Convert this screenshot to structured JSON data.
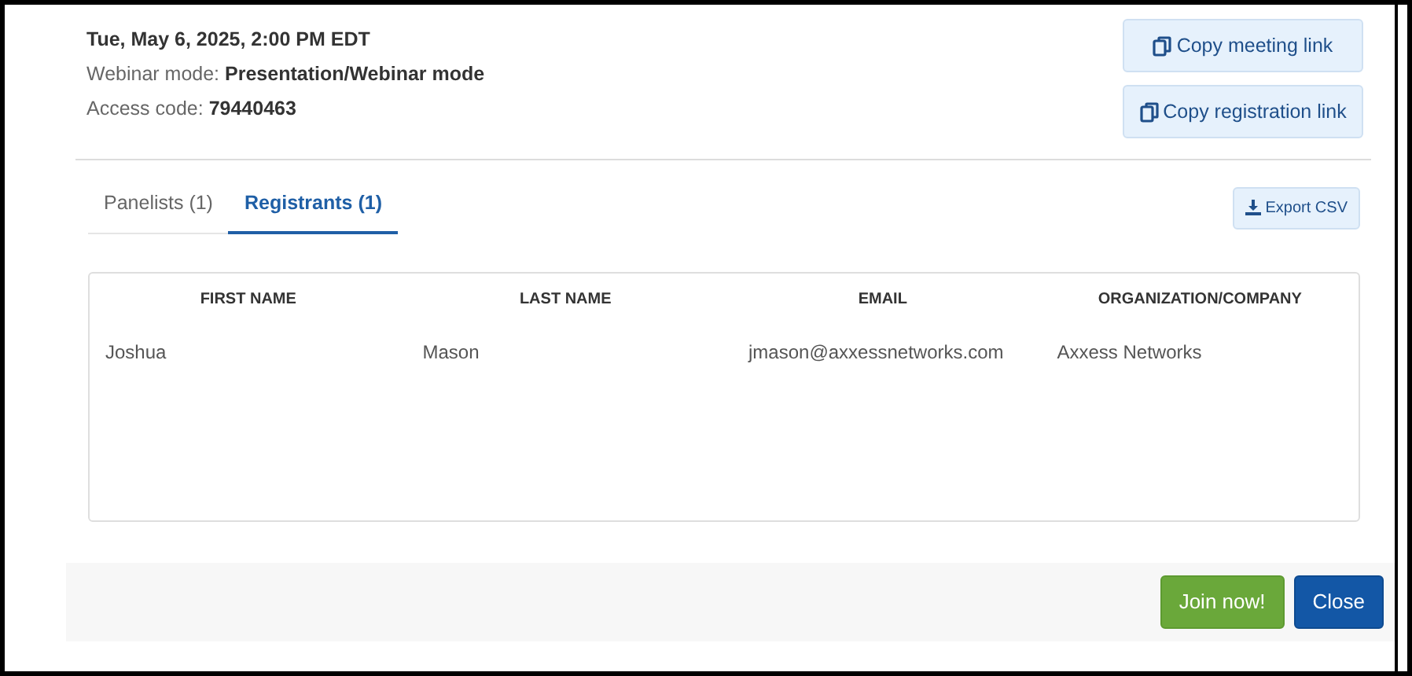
{
  "meeting": {
    "datetime": "Tue, May 6, 2025, 2:00 PM EDT",
    "mode_label": "Webinar mode: ",
    "mode_value": "Presentation/Webinar mode",
    "code_label": "Access code: ",
    "code_value": "79440463"
  },
  "link_buttons": [
    "Copy meeting link",
    "Copy registration link"
  ],
  "tabs": [
    {
      "label": "Panelists (1)",
      "selected": false
    },
    {
      "label": "Registrants (1)",
      "selected": true
    }
  ],
  "export_button": "Export CSV",
  "table": {
    "columns": [
      "FIRST NAME",
      "LAST NAME",
      "EMAIL",
      "ORGANIZATION/COMPANY"
    ],
    "rows": [
      [
        "Joshua",
        "Mason",
        "jmason@axxessnetworks.com",
        "Axxess Networks"
      ]
    ]
  },
  "footer_buttons": [
    {
      "label": "Join now!",
      "kind": "primary"
    },
    {
      "label": "Close",
      "kind": "secondary"
    }
  ]
}
